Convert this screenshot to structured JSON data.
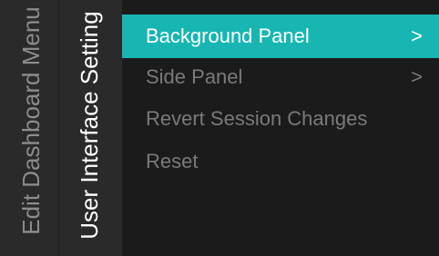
{
  "left_rail": {
    "breadcrumb_parent": "Edit Dashboard Menu",
    "breadcrumb_current": "User Interface Setting"
  },
  "menu": {
    "items": [
      {
        "label": "Background Panel",
        "chevron": ">",
        "selected": true
      },
      {
        "label": "Side Panel",
        "chevron": ">",
        "selected": false
      },
      {
        "label": "Revert Session Changes",
        "chevron": "",
        "selected": false
      },
      {
        "label": "Reset",
        "chevron": "",
        "selected": false
      }
    ]
  },
  "colors": {
    "background": "#1b1b1b",
    "rail_background": "#2a2a2a",
    "accent": "#17b6b2",
    "text_active": "#ffffff",
    "text_inactive": "#7a7a7a",
    "text_rail_inactive": "#8c8c8c"
  }
}
